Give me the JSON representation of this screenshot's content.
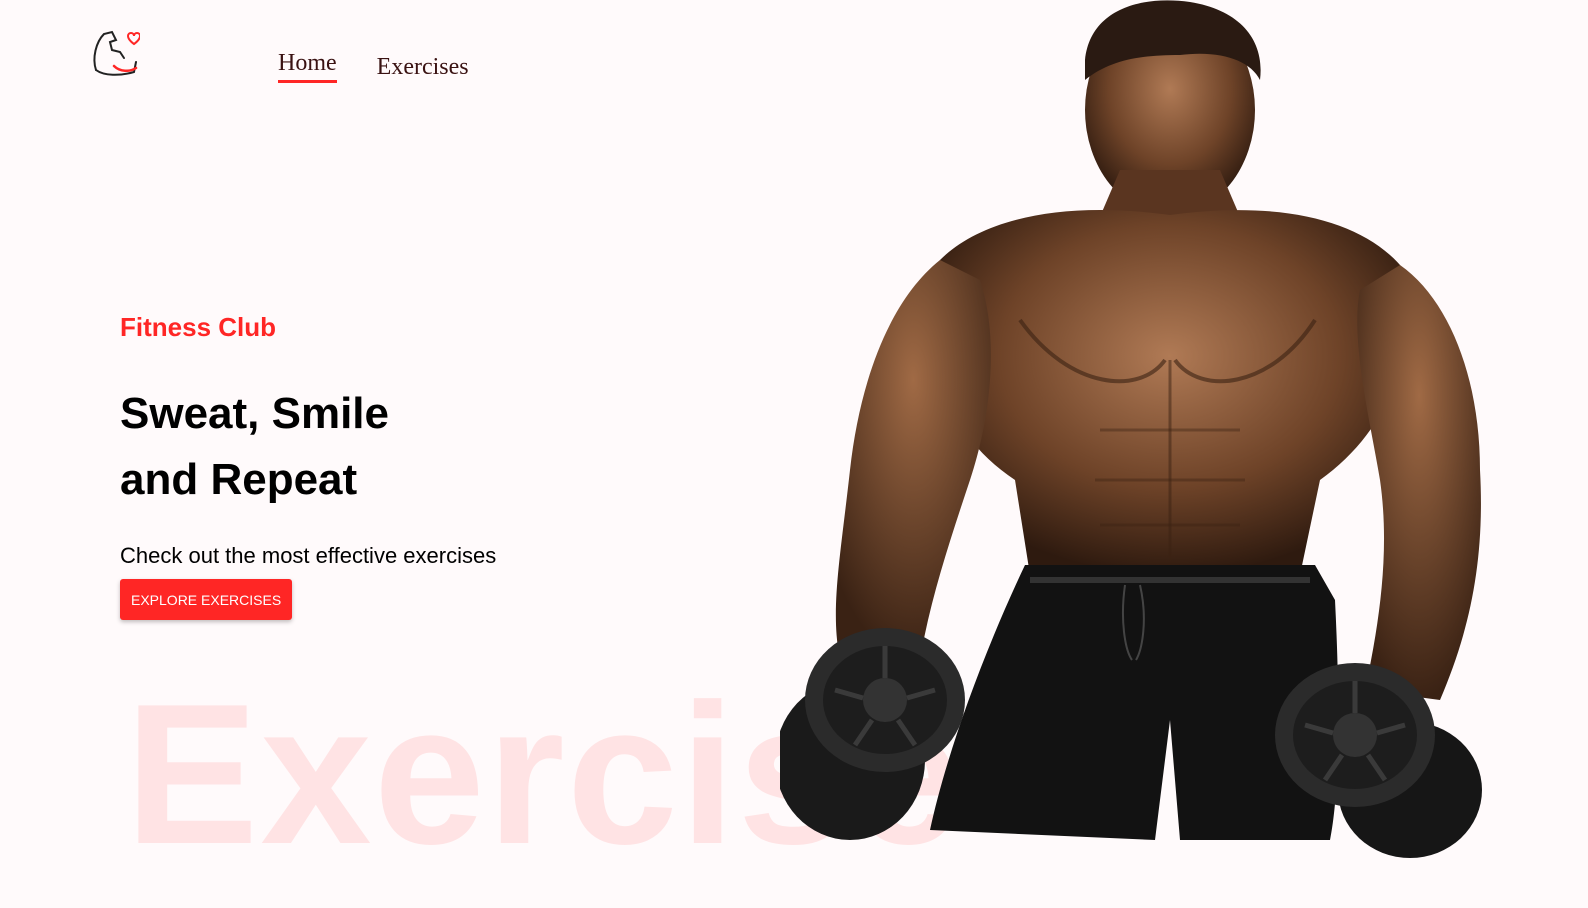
{
  "nav": {
    "items": [
      {
        "label": "Home",
        "active": true
      },
      {
        "label": "Exercises",
        "active": false
      }
    ]
  },
  "hero": {
    "eyebrow": "Fitness Club",
    "headline_line1": "Sweat, Smile",
    "headline_line2": "and Repeat",
    "subtitle": "Check out the most effective exercises",
    "cta_label": "Explore Exercises",
    "background_word": "Exercise"
  },
  "colors": {
    "accent": "#ff2625",
    "background": "#fffafb",
    "nav_text": "#3a1212"
  },
  "icons": {
    "logo": "flexed-arm-heart-icon",
    "banner": "bodybuilder-with-dumbbells-image"
  }
}
